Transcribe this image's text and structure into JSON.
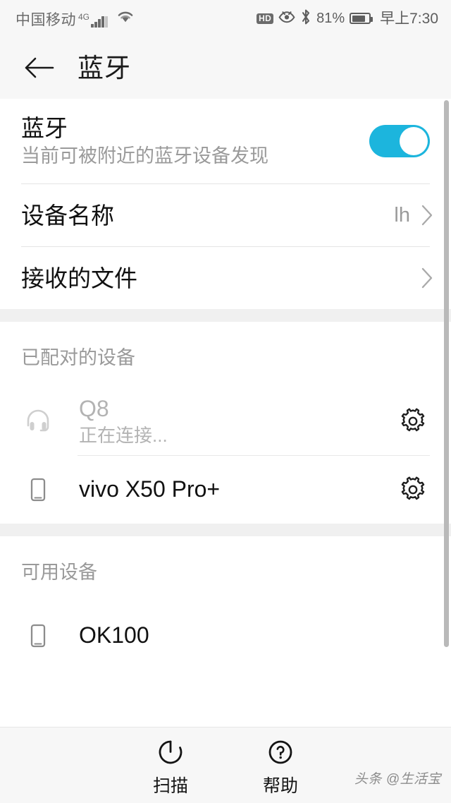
{
  "status_bar": {
    "carrier": "中国移动",
    "network_type": "4G",
    "wifi_icon": "wifi-icon",
    "hd_label": "HD",
    "eye_icon": "eye-comfort-icon",
    "bluetooth_icon": "bluetooth-icon",
    "battery_percent": "81%",
    "battery_level": 81,
    "clock": "早上7:30"
  },
  "title_bar": {
    "back_icon": "back-arrow-icon",
    "title": "蓝牙"
  },
  "bluetooth_master": {
    "title": "蓝牙",
    "subtitle": "当前可被附近的蓝牙设备发现",
    "enabled": true,
    "accent_color": "#1cb5dd"
  },
  "settings_rows": [
    {
      "label": "设备名称",
      "value": "lh",
      "chevron": true
    },
    {
      "label": "接收的文件",
      "value": "",
      "chevron": true
    }
  ],
  "paired_section": {
    "header": "已配对的设备",
    "devices": [
      {
        "name": "Q8",
        "status": "正在连接...",
        "icon": "headset-icon",
        "gear_icon": "gear-icon",
        "muted": true
      },
      {
        "name": "vivo X50 Pro+",
        "status": "",
        "icon": "phone-icon",
        "gear_icon": "gear-icon",
        "muted": false
      }
    ]
  },
  "available_section": {
    "header": "可用设备",
    "devices": [
      {
        "name": "OK100",
        "status": "",
        "icon": "phone-icon",
        "muted": false
      }
    ]
  },
  "bottom_bar": {
    "scan_label": "扫描",
    "scan_icon": "refresh-scan-icon",
    "help_label": "帮助",
    "help_icon": "question-circle-icon"
  },
  "watermark": "头条 @生活宝"
}
